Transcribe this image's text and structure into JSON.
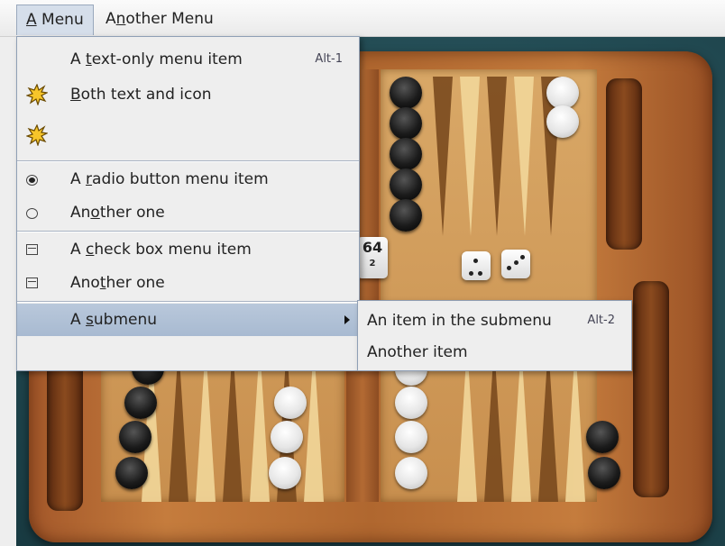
{
  "menubar": {
    "menu1": {
      "pre": "",
      "mn": "A",
      "post": " Menu"
    },
    "menu2": {
      "pre": "A",
      "mn": "n",
      "post": "other Menu"
    }
  },
  "menu1": {
    "text_item": {
      "pre": "A ",
      "mn": "t",
      "post": "ext-only menu item",
      "accel": "Alt-1"
    },
    "both_item": {
      "pre": "",
      "mn": "B",
      "post": "oth text and icon",
      "icon": "starburst-icon"
    },
    "icon_item": {
      "icon": "starburst-icon"
    },
    "radio1": {
      "pre": "A ",
      "mn": "r",
      "post": "adio button menu item",
      "selected": true
    },
    "radio2": {
      "pre": "An",
      "mn": "o",
      "post": "ther one",
      "selected": false
    },
    "check1": {
      "pre": "A ",
      "mn": "c",
      "post": "heck box menu item",
      "checked": false
    },
    "check2": {
      "pre": "Ano",
      "mn": "t",
      "post": "her one",
      "checked": false
    },
    "submenu": {
      "pre": "A ",
      "mn": "s",
      "post": "ubmenu"
    }
  },
  "submenu": {
    "item1": {
      "label": "An item in the submenu",
      "accel": "Alt-2"
    },
    "item2": {
      "label": "Another item"
    }
  },
  "game": {
    "doubling_cube": {
      "value": "64",
      "sub": "2"
    }
  },
  "colors": {
    "menu_bg": "#eeeeee",
    "selection": "#b9c8db",
    "table": "#1f454d"
  }
}
